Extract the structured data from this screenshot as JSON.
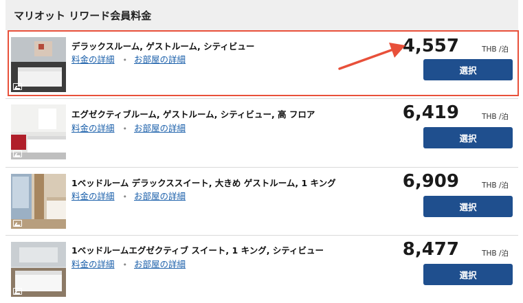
{
  "header": {
    "title": "マリオット リワード会員料金"
  },
  "links": {
    "rate_details": "料金の詳細",
    "room_details": "お部屋の詳細"
  },
  "rooms": [
    {
      "name": "デラックスルーム, ゲストルーム, シティビュー",
      "price": "4,557",
      "unit": "THB /泊",
      "select_label": "選択"
    },
    {
      "name": "エグゼクティブルーム, ゲストルーム, シティビュー, 高 フロア",
      "price": "6,419",
      "unit": "THB /泊",
      "select_label": "選択"
    },
    {
      "name": "1ベッドルーム デラックススイート, 大きめ ゲストルーム, 1 キング",
      "price": "6,909",
      "unit": "THB /泊",
      "select_label": "選択"
    },
    {
      "name": "1ベッドルームエグゼクティブ スイート, 1 キング, シティビュー",
      "price": "8,477",
      "unit": "THB /泊",
      "select_label": "選択"
    }
  ],
  "colors": {
    "button": "#1f4f8e",
    "link": "#1a5faa",
    "highlight": "#e8503a"
  },
  "icons": {
    "photo_gallery": "gallery-icon",
    "annotation": "arrow-icon"
  }
}
